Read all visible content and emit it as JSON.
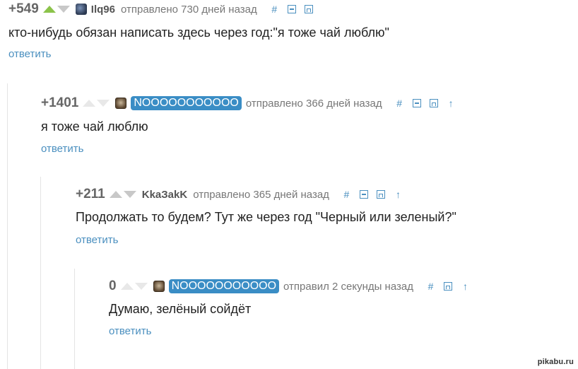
{
  "comments": [
    {
      "rating": "+549",
      "username": "Ilq96",
      "sent": "отправлено 730 дней назад",
      "text": "кто-нибудь обязан написать здесь через год:\"я тоже чай люблю\"",
      "reply": "ответить"
    },
    {
      "rating": "+1401",
      "username": "NOOOOOOOOOOO",
      "sent": "отправлено 366 дней назад",
      "text": "я тоже чай люблю",
      "reply": "ответить"
    },
    {
      "rating": "+211",
      "username": "KkaЗakK",
      "sent": "отправлено 365 дней назад",
      "text": "Продолжать то будем? Тут же через год \"Черный или зеленый?\"",
      "reply": "ответить"
    },
    {
      "rating": "0",
      "username": "NOOOOOOOOOOO",
      "sent": "отправил 2 секунды назад",
      "text": "Думаю, зелёный сойдёт",
      "reply": "ответить"
    }
  ],
  "icons": {
    "hash": "#",
    "up": "↑"
  },
  "watermark": "pikabu.ru"
}
